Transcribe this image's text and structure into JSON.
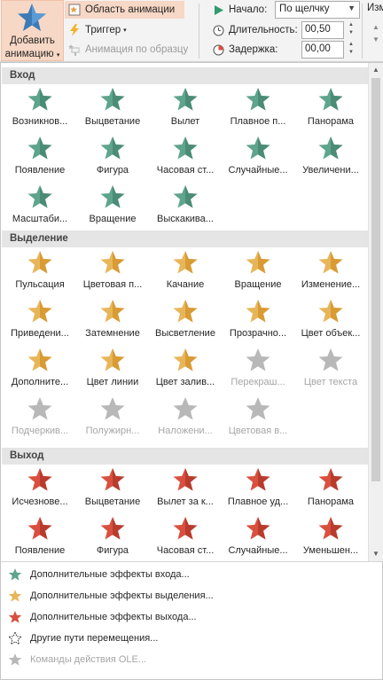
{
  "colors": {
    "entrance": "#5fa48c",
    "emphasis": "#e8b65a",
    "exit": "#d9503f",
    "disabled": "#b8b8b8",
    "highlight": "#f7d7c5"
  },
  "ribbon": {
    "add_animation_line1": "Добавить",
    "add_animation_line2": "анимацию",
    "animation_pane": "Область анимации",
    "trigger": "Триггер",
    "animation_painter": "Анимация по образцу",
    "start_label": "Начало:",
    "start_value": "По щелчку",
    "duration_label": "Длительность:",
    "duration_value": "00,50",
    "delay_label": "Задержка:",
    "delay_value": "00,00",
    "right_cut_label": "Изм"
  },
  "gallery": {
    "sections": [
      {
        "title": "Вход",
        "color": "entrance",
        "tiles": [
          {
            "label": "Возникнов...",
            "icon": "appear-icon",
            "disabled": false
          },
          {
            "label": "Выцветание",
            "icon": "fade-icon",
            "disabled": false
          },
          {
            "label": "Вылет",
            "icon": "fly-in-icon",
            "disabled": false
          },
          {
            "label": "Плавное п...",
            "icon": "float-in-icon",
            "disabled": false
          },
          {
            "label": "Панорама",
            "icon": "split-icon",
            "disabled": false
          },
          {
            "label": "Появление",
            "icon": "wipe-icon",
            "disabled": false
          },
          {
            "label": "Фигура",
            "icon": "shape-icon",
            "disabled": false
          },
          {
            "label": "Часовая ст...",
            "icon": "wheel-icon",
            "disabled": false
          },
          {
            "label": "Случайные...",
            "icon": "random-bars-icon",
            "disabled": false
          },
          {
            "label": "Увеличени...",
            "icon": "grow-turn-icon",
            "disabled": false
          },
          {
            "label": "Масштаби...",
            "icon": "zoom-icon",
            "disabled": false
          },
          {
            "label": "Вращение",
            "icon": "swivel-icon",
            "disabled": false
          },
          {
            "label": "Выскакива...",
            "icon": "bounce-icon",
            "disabled": false
          }
        ]
      },
      {
        "title": "Выделение",
        "color": "emphasis",
        "tiles": [
          {
            "label": "Пульсация",
            "icon": "pulse-icon",
            "disabled": false
          },
          {
            "label": "Цветовая п...",
            "icon": "color-pulse-icon",
            "disabled": false
          },
          {
            "label": "Качание",
            "icon": "teeter-icon",
            "disabled": false
          },
          {
            "label": "Вращение",
            "icon": "spin-icon",
            "disabled": false
          },
          {
            "label": "Изменение...",
            "icon": "grow-shrink-icon",
            "disabled": false
          },
          {
            "label": "Приведени...",
            "icon": "desaturate-icon",
            "disabled": false
          },
          {
            "label": "Затемнение",
            "icon": "darken-icon",
            "disabled": false
          },
          {
            "label": "Высветление",
            "icon": "lighten-icon",
            "disabled": false
          },
          {
            "label": "Прозрачно...",
            "icon": "transparency-icon",
            "disabled": false
          },
          {
            "label": "Цвет объек...",
            "icon": "object-color-icon",
            "disabled": false
          },
          {
            "label": "Дополните...",
            "icon": "complementary-color-icon",
            "disabled": false
          },
          {
            "label": "Цвет линии",
            "icon": "line-color-icon",
            "disabled": false
          },
          {
            "label": "Цвет залив...",
            "icon": "fill-color-icon",
            "disabled": false
          },
          {
            "label": "Перекраш...",
            "icon": "brush-color-icon",
            "disabled": true
          },
          {
            "label": "Цвет текста",
            "icon": "font-color-icon",
            "disabled": true
          },
          {
            "label": "Подчеркив...",
            "icon": "underline-icon",
            "disabled": true
          },
          {
            "label": "Полужирн...",
            "icon": "bold-flash-icon",
            "disabled": true
          },
          {
            "label": "Наложени...",
            "icon": "bold-reveal-icon",
            "disabled": true
          },
          {
            "label": "Цветовая в...",
            "icon": "wave-icon",
            "disabled": true
          }
        ]
      },
      {
        "title": "Выход",
        "color": "exit",
        "tiles": [
          {
            "label": "Исчезнове...",
            "icon": "disappear-icon",
            "disabled": false
          },
          {
            "label": "Выцветание",
            "icon": "exit-fade-icon",
            "disabled": false
          },
          {
            "label": "Вылет за к...",
            "icon": "fly-out-icon",
            "disabled": false
          },
          {
            "label": "Плавное уд...",
            "icon": "float-out-icon",
            "disabled": false
          },
          {
            "label": "Панорама",
            "icon": "exit-split-icon",
            "disabled": false
          },
          {
            "label": "Появление",
            "icon": "exit-wipe-icon",
            "disabled": false
          },
          {
            "label": "Фигура",
            "icon": "exit-shape-icon",
            "disabled": false
          },
          {
            "label": "Часовая ст...",
            "icon": "exit-wheel-icon",
            "disabled": false
          },
          {
            "label": "Случайные...",
            "icon": "exit-random-bars-icon",
            "disabled": false
          },
          {
            "label": "Уменьшен...",
            "icon": "shrink-turn-icon",
            "disabled": false
          }
        ]
      }
    ]
  },
  "more_effects": [
    {
      "label": "Дополнительные эффекты входа...",
      "icon": "entrance-star-icon",
      "color": "entrance",
      "disabled": false
    },
    {
      "label": "Дополнительные эффекты выделения...",
      "icon": "emphasis-star-icon",
      "color": "emphasis",
      "disabled": false
    },
    {
      "label": "Дополнительные эффекты выхода...",
      "icon": "exit-star-icon",
      "color": "exit",
      "disabled": false
    },
    {
      "label": "Другие пути перемещения...",
      "icon": "motion-path-star-icon",
      "color": "outline",
      "disabled": false
    },
    {
      "label": "Команды действия OLE...",
      "icon": "ole-action-icon",
      "color": "disabled",
      "disabled": true
    }
  ]
}
